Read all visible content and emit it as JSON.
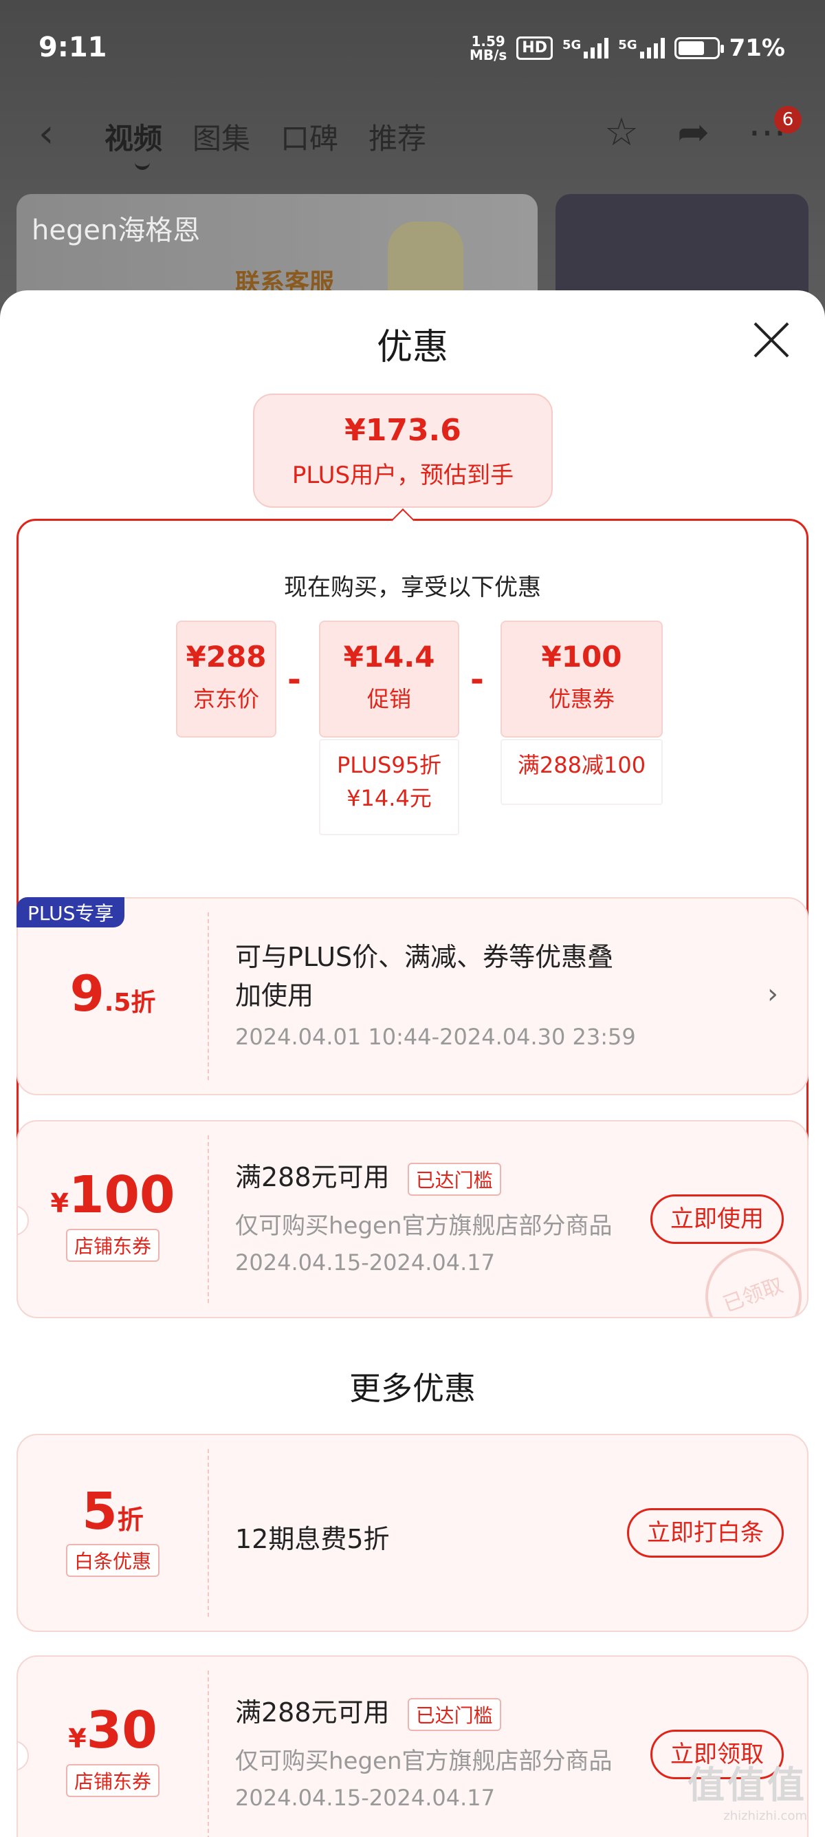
{
  "status_bar": {
    "time": "9:11",
    "speed_value": "1.59",
    "speed_unit": "MB/s",
    "hd": "HD",
    "net1": "5G",
    "net2": "5G",
    "battery": "71%"
  },
  "nav": {
    "tabs": [
      "视频",
      "图集",
      "口碑",
      "推荐"
    ],
    "more_badge": "6"
  },
  "bg": {
    "brand": "hegen海格恩",
    "kefu": "联系客服"
  },
  "sheet": {
    "title": "优惠",
    "estimate": {
      "price": "¥173.6",
      "label": "PLUS用户，预估到手"
    },
    "calc": {
      "heading": "现在购买，享受以下优惠",
      "items": [
        {
          "value": "¥288",
          "label": "京东价"
        },
        {
          "value": "¥14.4",
          "label": "促销",
          "note": "PLUS95折\n¥14.4元"
        },
        {
          "value": "¥100",
          "label": "优惠券",
          "note": "满288减100"
        }
      ],
      "minus": "-"
    },
    "cards": [
      {
        "badge": "PLUS专享",
        "big": "9",
        "big_suffix": ".5折",
        "title_line1": "可与PLUS价、满减、券等优惠叠",
        "title_line2": "加使用",
        "date": "2024.04.01 10:44-2024.04.30 23:59"
      },
      {
        "currency": "¥",
        "big": "100",
        "tag": "店铺东券",
        "title": "满288元可用",
        "status": "已达门槛",
        "sub": "仅可购买hegen官方旗舰店部分商品",
        "date": "2024.04.15-2024.04.17",
        "button": "立即使用",
        "stamp": "已领取"
      }
    ],
    "more_title": "更多优惠",
    "more_cards": [
      {
        "big": "5",
        "big_suffix": "折",
        "tag": "白条优惠",
        "title": "12期息费5折",
        "button": "立即打白条"
      },
      {
        "currency": "¥",
        "big": "30",
        "tag": "店铺东券",
        "title": "满288元可用",
        "status": "已达门槛",
        "sub": "仅可购买hegen官方旗舰店部分商品",
        "date": "2024.04.15-2024.04.17",
        "button": "立即领取"
      }
    ]
  },
  "watermark": {
    "big": "值值值",
    "small": "zhizhizhi.com"
  }
}
